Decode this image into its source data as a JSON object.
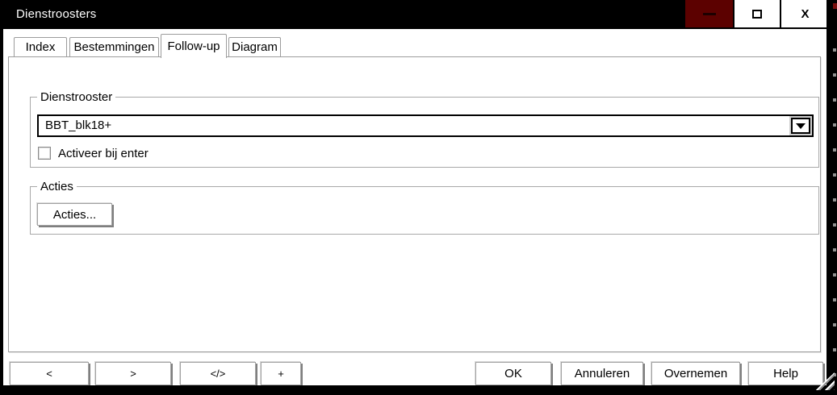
{
  "window": {
    "title": "Dienstroosters",
    "controls": {
      "minimize_icon": "minimize-dash",
      "maximize_icon": "maximize-square",
      "close_label": "X"
    }
  },
  "tabs": [
    {
      "label": "Index",
      "active": false
    },
    {
      "label": "Bestemmingen",
      "active": false
    },
    {
      "label": "Follow-up",
      "active": true
    },
    {
      "label": "Diagram",
      "active": false
    }
  ],
  "groups": {
    "dienstrooster": {
      "label": "Dienstrooster",
      "combobox": {
        "value": "BBT_blk18+",
        "icon": "chevron-down-icon"
      },
      "checkbox": {
        "label": "Activeer bij enter",
        "checked": false
      }
    },
    "acties": {
      "label": "Acties",
      "button_label": "Acties..."
    }
  },
  "nav_buttons": [
    {
      "label": "<"
    },
    {
      "label": ">"
    },
    {
      "label": "</>"
    },
    {
      "label": "+"
    }
  ],
  "dialog_buttons": [
    {
      "label": "OK"
    },
    {
      "label": "Annuleren"
    },
    {
      "label": "Overnemen"
    },
    {
      "label": "Help"
    }
  ],
  "colors": {
    "titlebar": "#000000",
    "minimize_button": "#5c0100",
    "field_border": "#000000",
    "group_border": "#a8a8a8"
  }
}
